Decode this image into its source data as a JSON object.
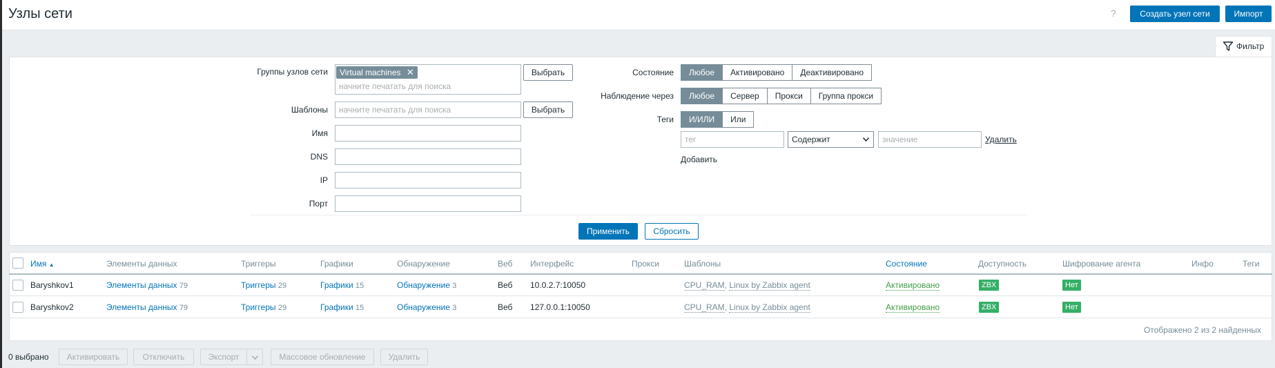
{
  "header": {
    "title": "Узлы сети",
    "help": "?",
    "create_button": "Создать узел сети",
    "import_button": "Импорт"
  },
  "filter_tab": {
    "label": "Фильтр"
  },
  "filter": {
    "host_groups": {
      "label": "Группы узлов сети",
      "chip": "Virtual machines",
      "placeholder": "начните печатать для поиска",
      "select_button": "Выбрать"
    },
    "templates": {
      "label": "Шаблоны",
      "placeholder": "начните печатать для поиска",
      "select_button": "Выбрать"
    },
    "name": {
      "label": "Имя",
      "value": ""
    },
    "dns": {
      "label": "DNS",
      "value": ""
    },
    "ip": {
      "label": "IP",
      "value": ""
    },
    "port": {
      "label": "Порт",
      "value": ""
    },
    "status": {
      "label": "Состояние",
      "options": [
        "Любое",
        "Активировано",
        "Деактивировано"
      ],
      "selected": "Любое"
    },
    "monitored_by": {
      "label": "Наблюдение через",
      "options": [
        "Любое",
        "Сервер",
        "Прокси",
        "Группа прокси"
      ],
      "selected": "Любое"
    },
    "tags": {
      "label": "Теги",
      "options": [
        "И/ИЛИ",
        "Или"
      ],
      "selected": "И/ИЛИ",
      "tag_placeholder": "тег",
      "operator": "Содержит",
      "value_placeholder": "значение",
      "remove_link": "Удалить",
      "add_link": "Добавить"
    },
    "apply_button": "Применить",
    "reset_button": "Сбросить"
  },
  "table": {
    "columns": {
      "name": "Имя",
      "sort_indicator": "▲",
      "items": "Элементы данных",
      "triggers": "Триггеры",
      "graphs": "Графики",
      "discovery": "Обнаружение",
      "web": "Веб",
      "interface": "Интерфейс",
      "proxy": "Прокси",
      "templates": "Шаблоны",
      "status": "Состояние",
      "availability": "Доступность",
      "encryption": "Шифрование агента",
      "info": "Инфо",
      "tags": "Теги"
    },
    "rows": [
      {
        "name": "Baryshkov1",
        "items_label": "Элементы данных",
        "items_count": "79",
        "triggers_label": "Триггеры",
        "triggers_count": "29",
        "graphs_label": "Графики",
        "graphs_count": "15",
        "discovery_label": "Обнаружение",
        "discovery_count": "3",
        "web": "Веб",
        "interface": "10.0.2.7:10050",
        "template_1": "CPU_RAM",
        "template_sep": ",",
        "template_2": "Linux by Zabbix agent",
        "status": "Активировано",
        "availability": "ZBX",
        "encryption": "Нет"
      },
      {
        "name": "Baryshkov2",
        "items_label": "Элементы данных",
        "items_count": "79",
        "triggers_label": "Триггеры",
        "triggers_count": "29",
        "graphs_label": "Графики",
        "graphs_count": "15",
        "discovery_label": "Обнаружение",
        "discovery_count": "3",
        "web": "Веб",
        "interface": "127.0.0.1:10050",
        "template_1": "CPU_RAM",
        "template_sep": ",",
        "template_2": "Linux by Zabbix agent",
        "status": "Активировано",
        "availability": "ZBX",
        "encryption": "Нет"
      }
    ],
    "summary": "Отображено 2 из 2 найденных"
  },
  "footer": {
    "selected": "0 выбрано",
    "activate": "Активировать",
    "disable": "Отключить",
    "export": "Экспорт",
    "mass_update": "Массовое обновление",
    "delete": "Удалить"
  },
  "colors": {
    "primary": "#0275b8",
    "segment_active": "#768d99",
    "status_enabled": "#429e47",
    "badge_green": "#34af67"
  }
}
